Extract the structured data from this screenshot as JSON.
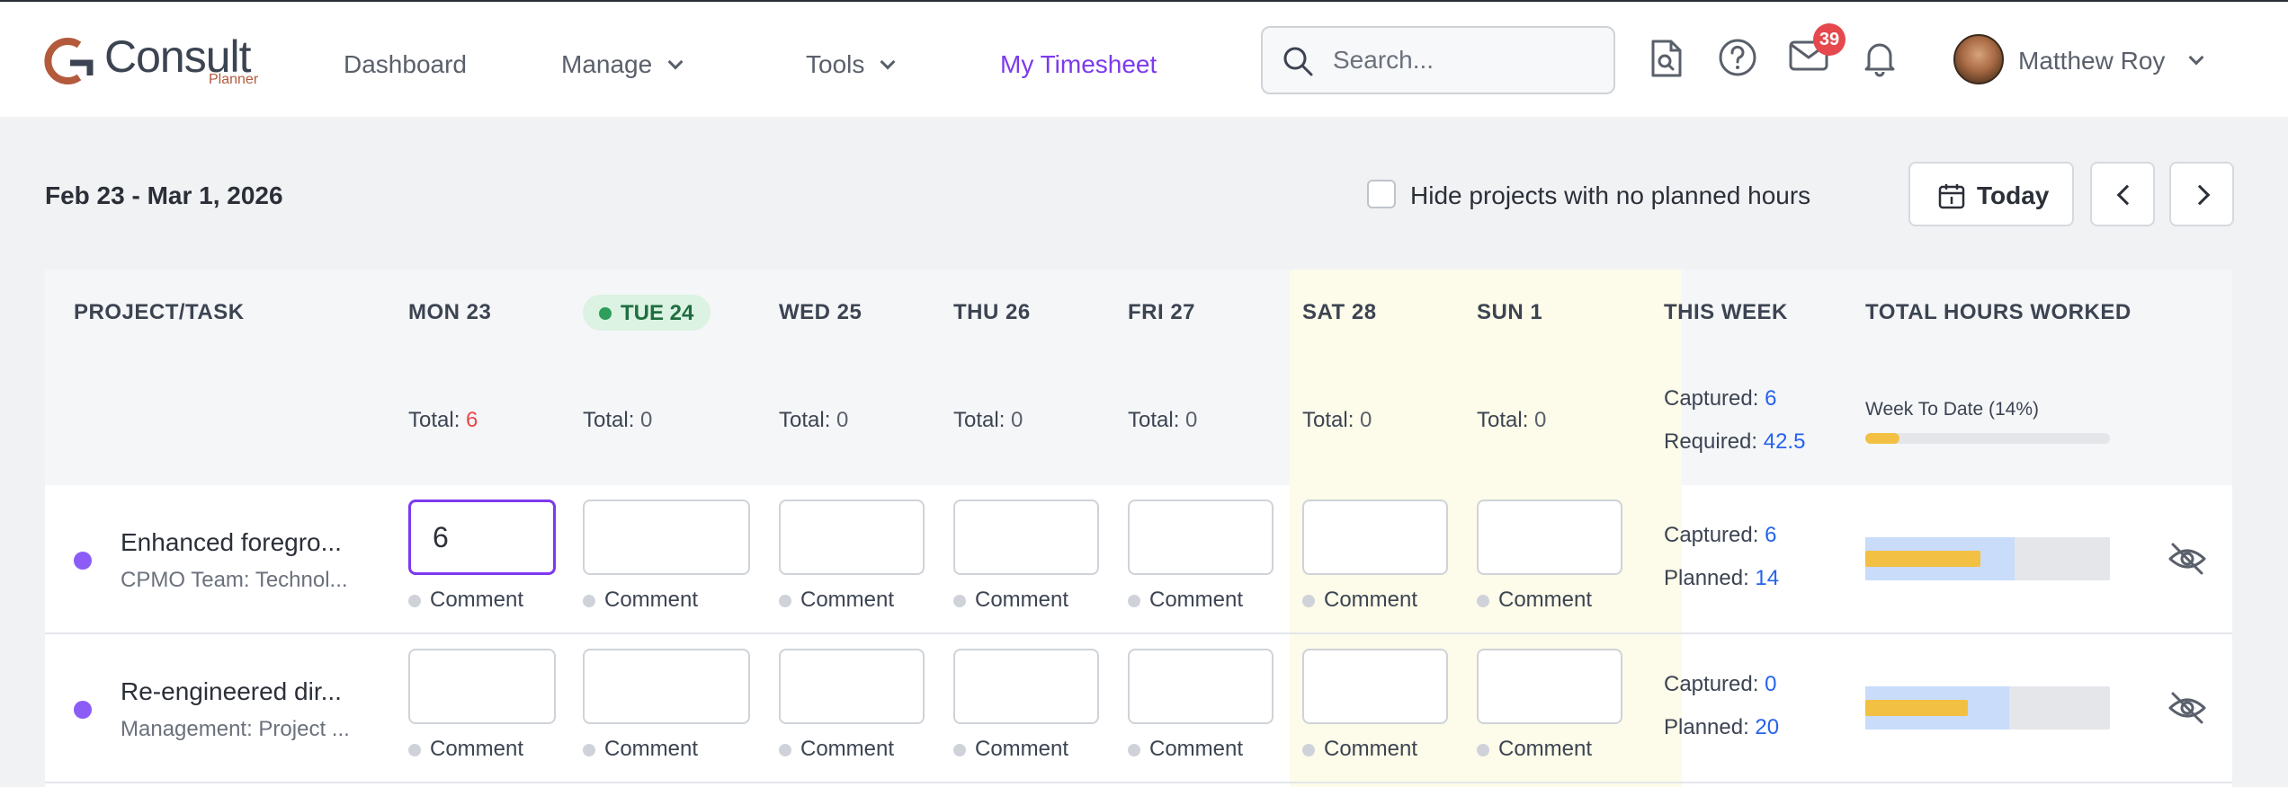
{
  "app": {
    "logo_text": "Consult",
    "logo_sub": "Planner"
  },
  "nav": {
    "dashboard": "Dashboard",
    "manage": "Manage",
    "tools": "Tools",
    "timesheet": "My Timesheet"
  },
  "search": {
    "placeholder": "Search..."
  },
  "header_icons": [
    "document-search-icon",
    "help-icon",
    "mail-icon",
    "bell-icon"
  ],
  "notifications": {
    "mail_count": "39"
  },
  "user": {
    "name": "Matthew Roy"
  },
  "toolbar": {
    "date_range": "Feb 23 - Mar 1, 2026",
    "hide_label": "Hide projects with no planned hours",
    "today_label": "Today"
  },
  "columns": {
    "project": "PROJECT/TASK",
    "days": [
      "MON 23",
      "TUE 24",
      "WED 25",
      "THU 26",
      "FRI 27",
      "SAT 28",
      "SUN 1"
    ],
    "this_week": "THIS WEEK",
    "total_hours": "TOTAL HOURS WORKED"
  },
  "totals": {
    "label": "Total:",
    "values": [
      "6",
      "0",
      "0",
      "0",
      "0",
      "0",
      "0"
    ]
  },
  "week_summary": {
    "captured_label": "Captured:",
    "captured": "6",
    "required_label": "Required:",
    "required": "42.5",
    "wtd_label": "Week To Date (14%)",
    "wtd_fraction": 0.14
  },
  "rows": [
    {
      "title": "Enhanced foregro...",
      "subtitle": "CPMO Team: Technol...",
      "hours": [
        "6",
        "",
        "",
        "",
        "",
        "",
        ""
      ],
      "comment_label": "Comment",
      "captured_label": "Captured:",
      "captured": "6",
      "planned_label": "Planned:",
      "planned": "14",
      "planned_fraction": 0.61,
      "captured_fraction": 0.47
    },
    {
      "title": "Re-engineered dir...",
      "subtitle": "Management: Project ...",
      "hours": [
        "",
        "",
        "",
        "",
        "",
        "",
        ""
      ],
      "comment_label": "Comment",
      "captured_label": "Captured:",
      "captured": "0",
      "planned_label": "Planned:",
      "planned": "20",
      "planned_fraction": 0.59,
      "captured_fraction": 0.42
    }
  ],
  "colors": {
    "accent": "#7c3aed",
    "today_green": "#2e9e5b",
    "weekend_bg": "#fdfbe9",
    "value_blue": "#2563eb",
    "captured_bar": "#f2c043",
    "planned_bar": "#c9dcfa"
  }
}
